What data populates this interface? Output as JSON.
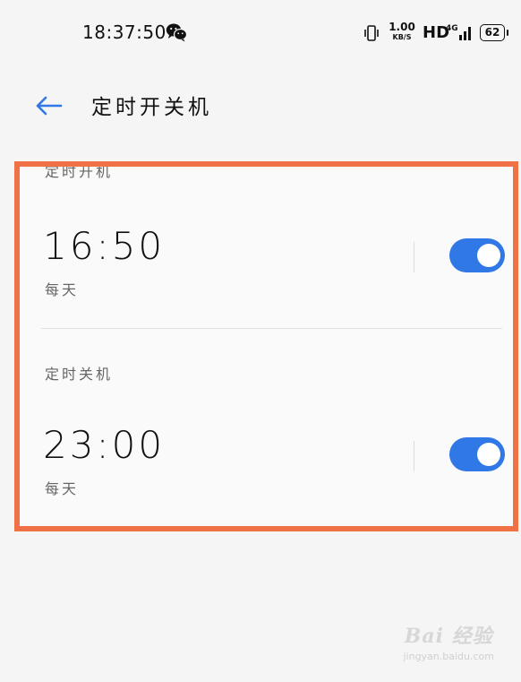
{
  "status_bar": {
    "time": "18:37:50",
    "net_speed_value": "1.00",
    "net_speed_unit": "KB/S",
    "hd_label": "HD",
    "signal_label": "4G",
    "battery_level": "62",
    "icons": [
      "wechat-icon",
      "vibrate-icon",
      "signal-icon",
      "battery-icon"
    ]
  },
  "header": {
    "back_icon": "arrow-left-icon",
    "title": "定时开关机"
  },
  "schedules": {
    "power_on": {
      "label": "定时开机",
      "time": "16:50",
      "repeat": "每天",
      "enabled": true
    },
    "power_off": {
      "label": "定时关机",
      "time": "23:00",
      "repeat": "每天",
      "enabled": true
    }
  },
  "watermark": {
    "main": "Bai 经验",
    "sub": "jingyan.baidu.com"
  },
  "colors": {
    "accent_blue": "#2f78e6",
    "highlight_frame": "#f07146",
    "background": "#f5f5f5"
  }
}
